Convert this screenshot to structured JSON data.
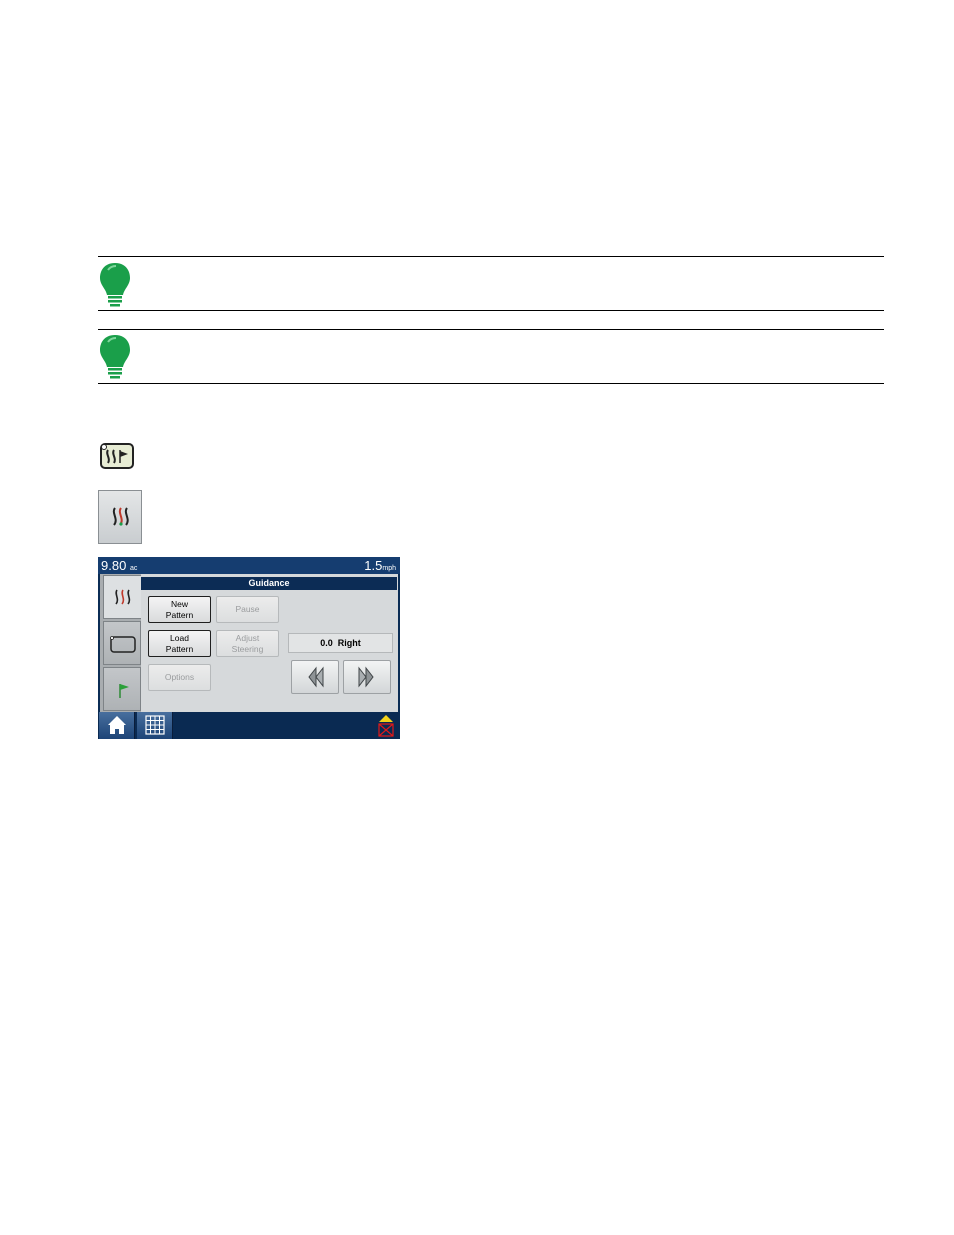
{
  "screen": {
    "status_bar": {
      "area_value": "9.80",
      "area_unit": "ac",
      "speed_value": "1.5",
      "speed_unit": "mph"
    },
    "title": "Guidance",
    "buttons": {
      "new_pattern": "New\nPattern",
      "pause": "Pause",
      "load_pattern": "Load\nPattern",
      "adjust_steering": "Adjust\nSteering",
      "options": "Options"
    },
    "offset_readout": "0.0  Right",
    "tabs": [
      "guidance-tab",
      "field-tab",
      "marks-tab"
    ],
    "bottom": [
      "home",
      "grid-menu",
      "gps-status"
    ]
  },
  "colors": {
    "bulb_green": "#1a9f4a",
    "header_navy": "#0c2c55",
    "bar_blue": "#153d70"
  }
}
